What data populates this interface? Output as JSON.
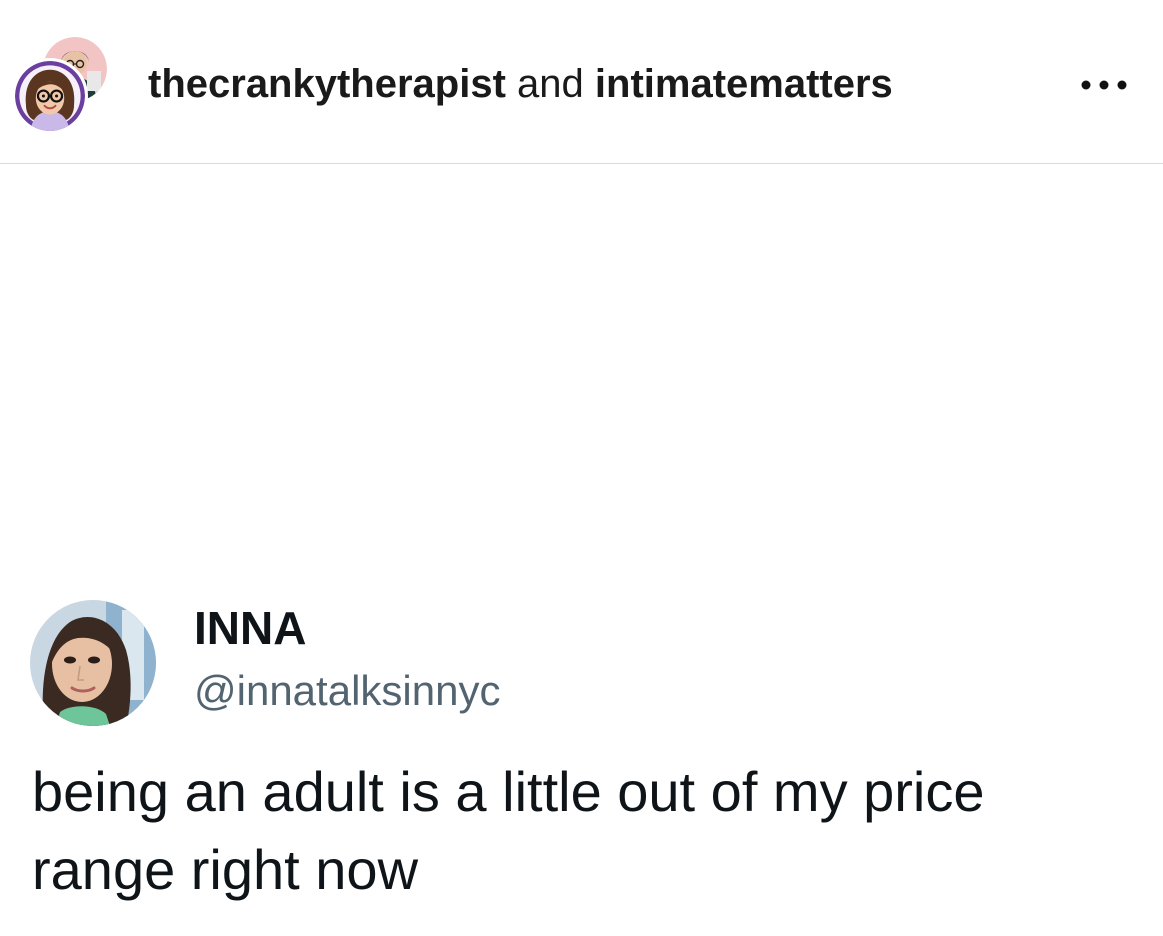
{
  "header": {
    "username_primary": "thecrankytherapist",
    "conjunction": "and",
    "username_collaborator": "intimatematters",
    "more_icon": "more-horizontal-icon"
  },
  "post": {
    "tweet": {
      "display_name": "INNA",
      "handle": "@innatalksinnyc",
      "text": "being an adult is a little out of my price range right now"
    }
  },
  "colors": {
    "primary_text": "#0f1419",
    "secondary_text": "#536471",
    "divider": "#dbdbdb",
    "background": "#ffffff"
  }
}
